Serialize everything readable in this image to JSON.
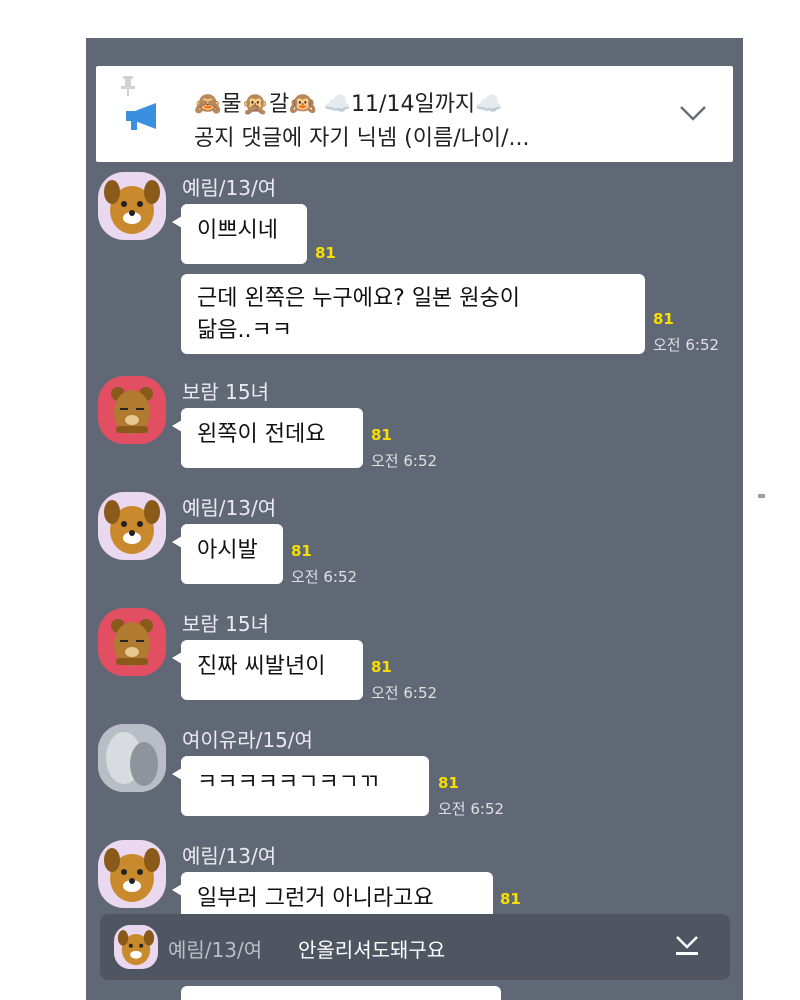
{
  "notice": {
    "line1": "🙈물🙊갈🙉 ☁️11/14일까지☁️",
    "line2": "공지 댓글에 자기 닉넴 (이름/나이/..."
  },
  "messages": [
    {
      "sender": "예림/13/여",
      "text": "이쁘시네",
      "count": "81"
    },
    {
      "text_line1": "근데 왼쪽은 누구에요? 일본 원숭이",
      "text_line2": "닮음..ㅋㅋ",
      "count": "81",
      "time": "오전 6:52"
    },
    {
      "sender": "보람 15녀",
      "text": "왼쪽이 전데요",
      "count": "81",
      "time": "오전 6:52"
    },
    {
      "sender": "예림/13/여",
      "text": "아시발",
      "count": "81",
      "time": "오전 6:52"
    },
    {
      "sender": "보람 15녀",
      "text": "진짜 씨발년이",
      "count": "81",
      "time": "오전 6:52"
    },
    {
      "sender": "여이유라/15/여",
      "text": "ㅋㅋㅋㅋㅋㄱㅋㄱㄲ",
      "count": "81",
      "time": "오전 6:52"
    },
    {
      "sender": "예림/13/여",
      "text": "일부러 그런거 아니라고요",
      "count": "81"
    }
  ],
  "preview": {
    "sender": "예림/13/여",
    "text": "안올리셔도돼구요"
  },
  "colors": {
    "chat_background": "#606875",
    "bubble": "#ffffff",
    "unread_count": "#f7e000",
    "preview_bar": "#4f5661"
  },
  "icons": {
    "notice_pin": "pin-icon",
    "notice_megaphone": "megaphone-icon",
    "notice_expand": "chevron-down-icon",
    "preview_jump": "arrow-down-icon"
  }
}
